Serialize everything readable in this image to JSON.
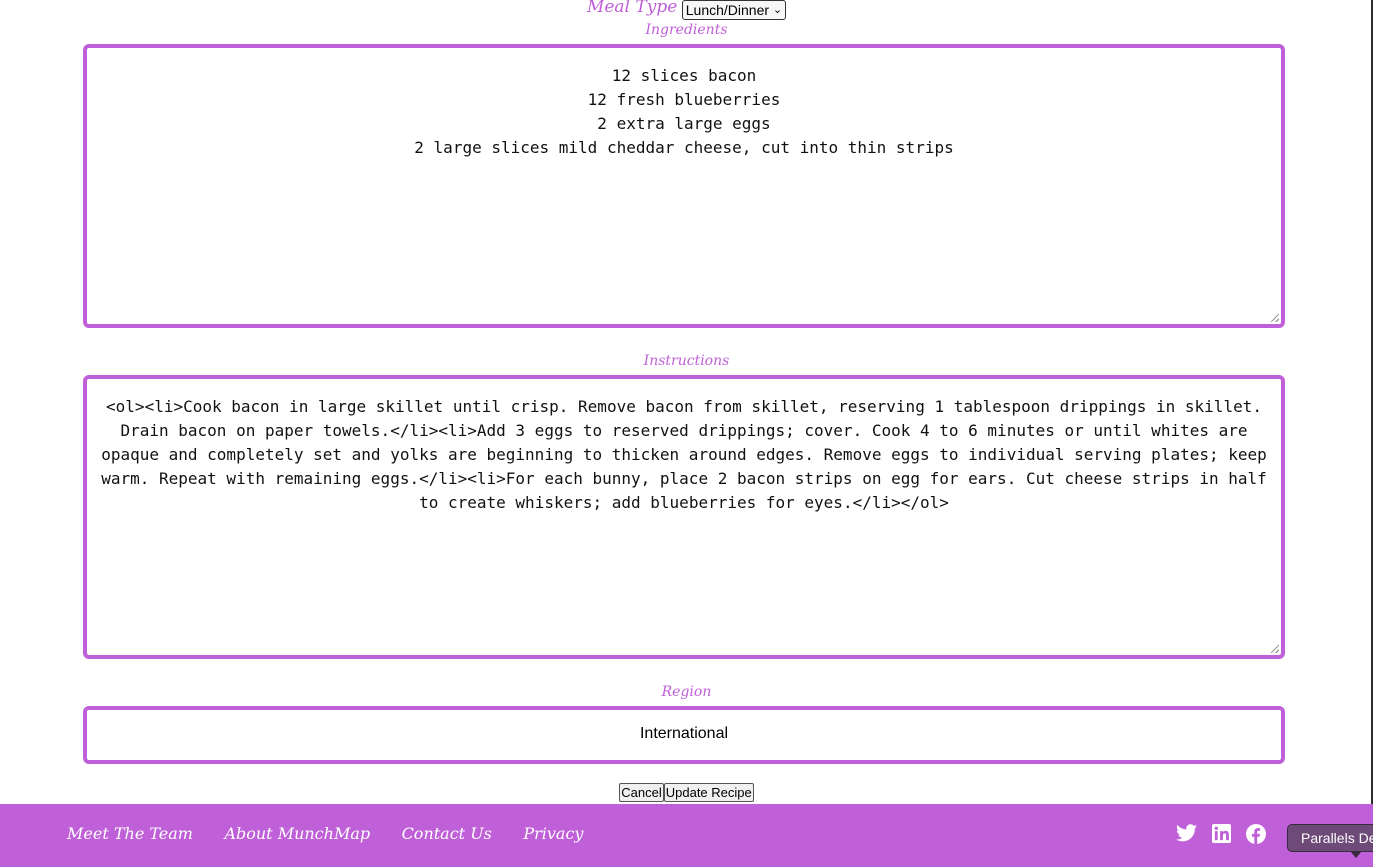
{
  "meal_type": {
    "label": "Meal Type",
    "selected": "Lunch/Dinner"
  },
  "ingredients": {
    "label": "Ingredients",
    "value": "12 slices bacon\n12 fresh blueberries\n2 extra large eggs\n2 large slices mild cheddar cheese, cut into thin strips"
  },
  "instructions": {
    "label": "Instructions",
    "value": "<ol><li>Cook bacon in large skillet until crisp. Remove bacon from skillet, reserving 1 tablespoon drippings in skillet.\nDrain bacon on paper towels.</li><li>Add 3 eggs to reserved drippings; cover. Cook 4 to 6 minutes or until whites are\nopaque and completely set and yolks are beginning to thicken around edges. Remove eggs to individual serving plates; keep\nwarm. Repeat with remaining eggs.</li><li>For each bunny, place 2 bacon strips on egg for ears. Cut cheese strips in half\nto create whiskers; add blueberries for eyes.</li></ol>"
  },
  "region": {
    "label": "Region",
    "value": "International"
  },
  "buttons": {
    "cancel": "Cancel",
    "update": "Update Recipe"
  },
  "footer": {
    "links": [
      "Meet The Team",
      "About MunchMap",
      "Contact Us",
      "Privacy"
    ],
    "social_icons": [
      "twitter-icon",
      "linkedin-icon",
      "facebook-icon"
    ]
  },
  "tooltip": {
    "text": "Parallels De"
  },
  "colors": {
    "accent": "#c060d8",
    "footer_bg": "#c060d8",
    "tooltip_bg": "#6d4a78"
  }
}
